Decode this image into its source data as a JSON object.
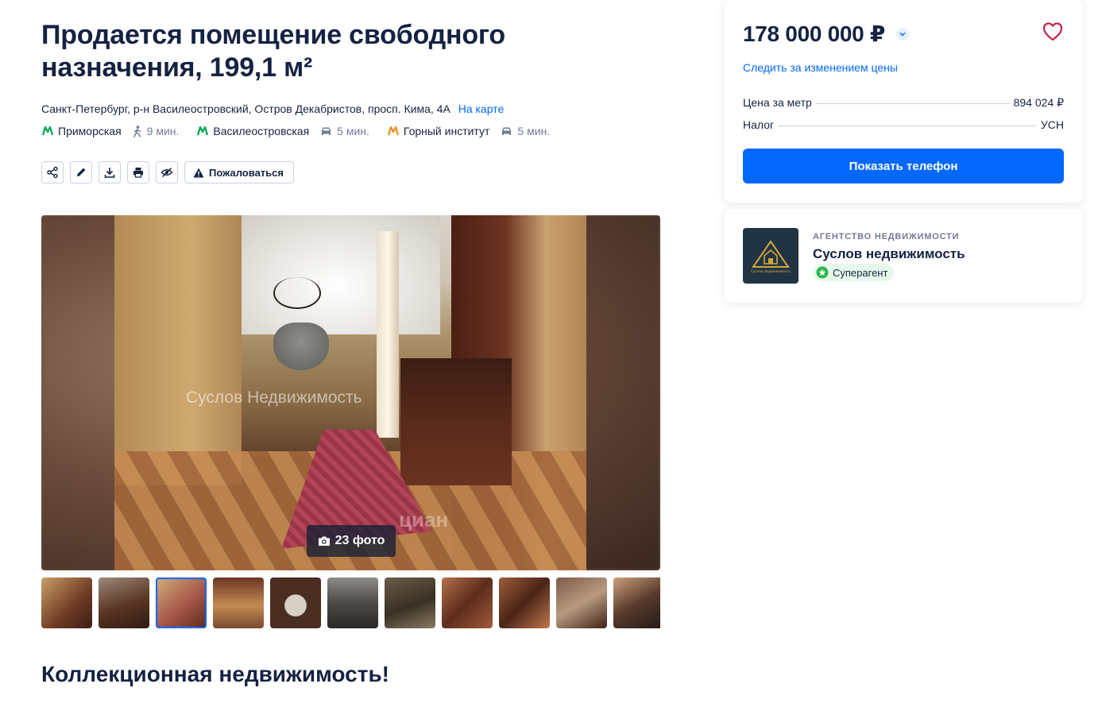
{
  "listing": {
    "title": "Продается помещение свободного назначения, 199,1 м²",
    "address": "Санкт-Петербург, р-н Василеостровский, Остров Декабристов, просп. Кима, 4А",
    "map_link": "На карте",
    "metro": [
      {
        "name": "Приморская",
        "time": "9 мин.",
        "mode": "walk",
        "color": "#00a651"
      },
      {
        "name": "Василеостровская",
        "time": "5 мин.",
        "mode": "car",
        "color": "#00a651"
      },
      {
        "name": "Горный институт",
        "time": "5 мин.",
        "mode": "car",
        "color": "#f08a1c"
      }
    ],
    "complain_label": "Пожаловаться",
    "section_title": "Коллекционная недвижимость!"
  },
  "gallery": {
    "watermark": "Суслов Недвижимость",
    "photo_mark": "циан",
    "photo_count": "23 фото",
    "active_thumb": 3,
    "thumb_count": 11
  },
  "price_card": {
    "price": "178 000 000 ₽",
    "watch_link": "Следить за изменением цены",
    "rows": [
      {
        "label": "Цена за метр",
        "value": "894 024 ₽"
      },
      {
        "label": "Налог",
        "value": "УСН"
      }
    ],
    "phone_button": "Показать телефон"
  },
  "agent": {
    "type": "АГЕНТСТВО НЕДВИЖИМОСТИ",
    "name": "Суслов недвижимость",
    "badge": "Суперагент",
    "logo_text": "Суслов Недвижимость"
  },
  "colors": {
    "accent": "#0468ff",
    "text": "#152242",
    "muted": "#707a95",
    "favorite": "#c1234b",
    "superagent": "#2cb84b"
  }
}
